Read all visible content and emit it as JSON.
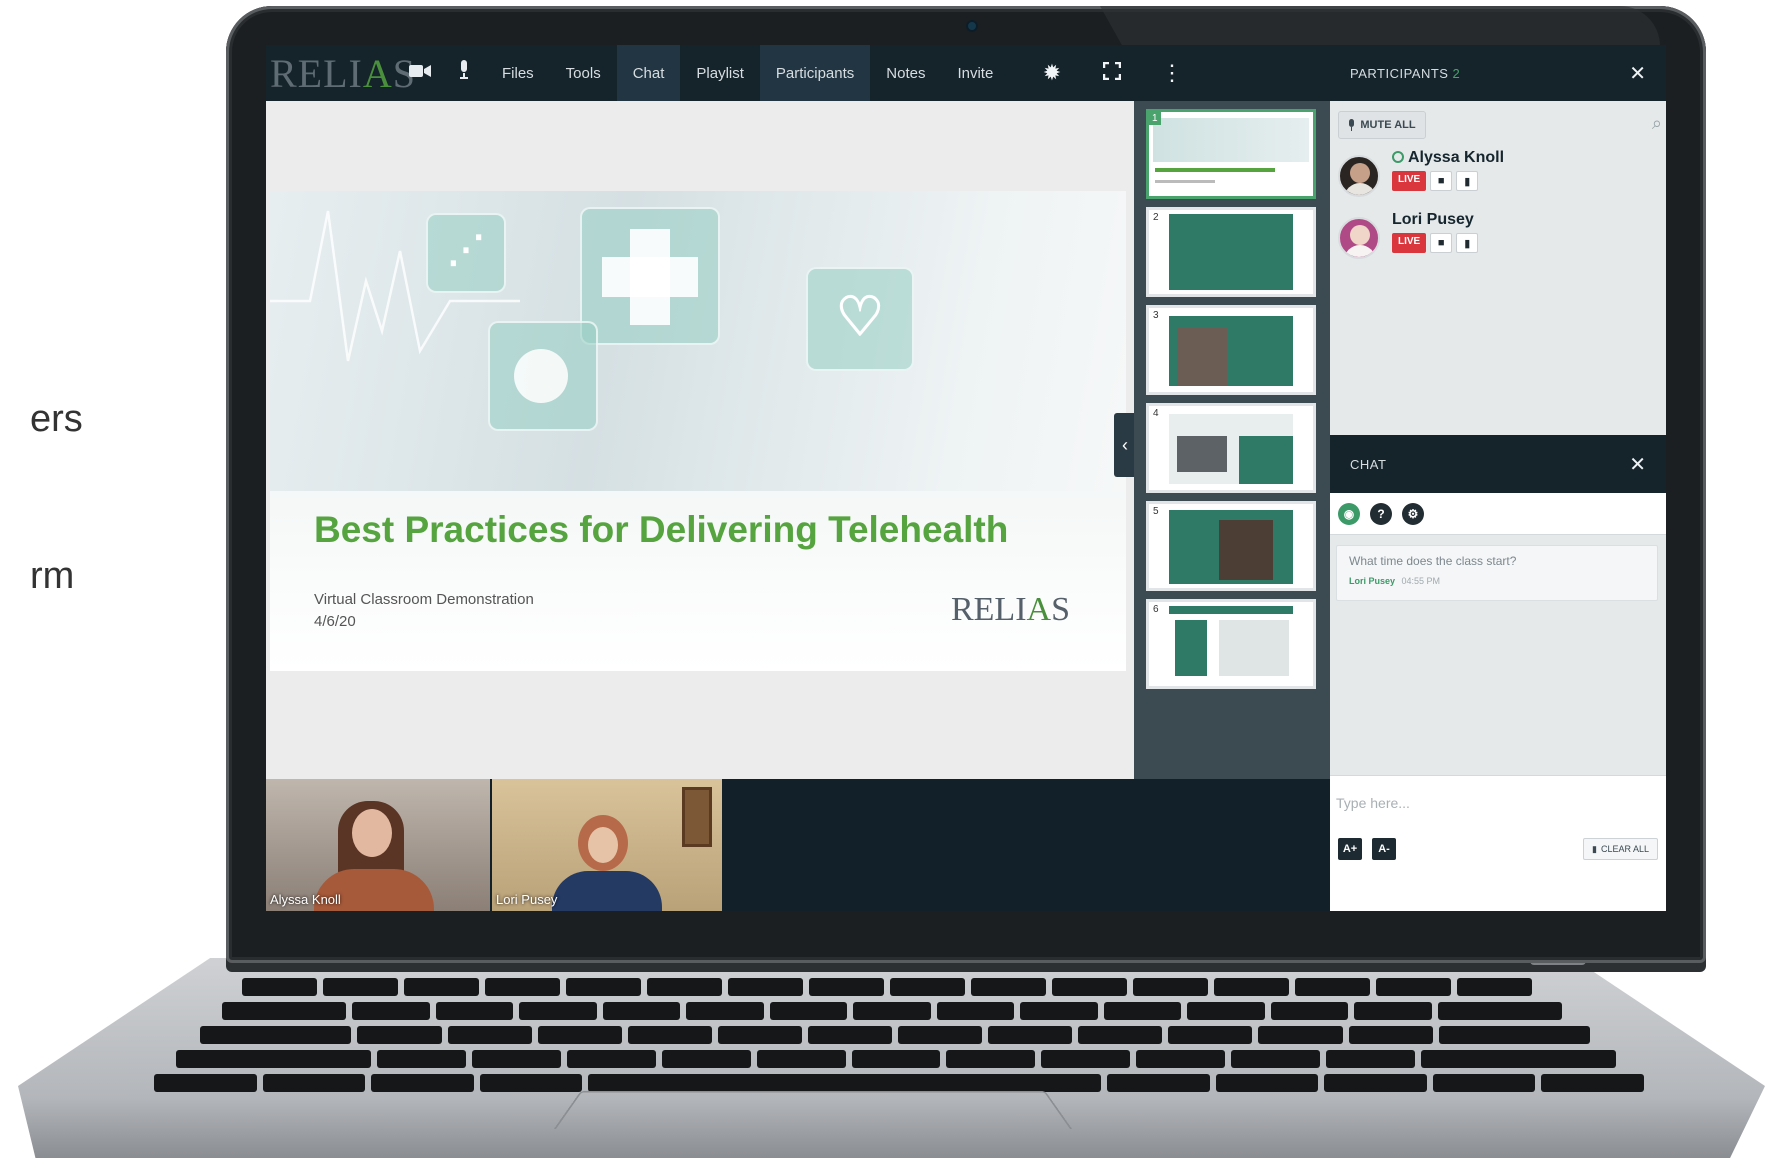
{
  "background_text": {
    "line1": "ers",
    "line2": "rm"
  },
  "topbar": {
    "logo": {
      "pre": "REL",
      "accent": "A",
      "post": "S",
      "accent_lead": "I"
    },
    "icons": {
      "camera": "video-camera-icon",
      "mic": "microphone-icon",
      "settings": "gear-icon",
      "fullscreen": "fullscreen-icon",
      "more": "more-vertical-icon"
    },
    "nav": [
      {
        "label": "Files"
      },
      {
        "label": "Tools"
      },
      {
        "label": "Chat"
      },
      {
        "label": "Playlist"
      },
      {
        "label": "Participants"
      },
      {
        "label": "Notes"
      },
      {
        "label": "Invite"
      }
    ]
  },
  "participants_panel": {
    "title": "PARTICIPANTS",
    "count": "2",
    "mute_all_label": "MUTE ALL",
    "people": [
      {
        "name": "Alyssa Knoll",
        "status": "LIVE"
      },
      {
        "name": "Lori Pusey",
        "status": "LIVE"
      }
    ]
  },
  "slide": {
    "title": "Best Practices for Delivering Telehealth",
    "subtitle": "Virtual Classroom Demonstration",
    "date": "4/6/20",
    "logo": {
      "pre": "REL",
      "accent": "A",
      "post": "S",
      "accent_lead": "I"
    }
  },
  "thumbnails": [
    {
      "number": "1"
    },
    {
      "number": "2"
    },
    {
      "number": "3"
    },
    {
      "number": "4"
    },
    {
      "number": "5"
    },
    {
      "number": "6"
    }
  ],
  "chat": {
    "title": "CHAT",
    "messages": [
      {
        "text": "What time does the class start?",
        "author": "Lori Pusey",
        "time": "04:55 PM"
      }
    ],
    "input_placeholder": "Type here...",
    "font_increase": "A+",
    "font_decrease": "A-",
    "clear_all_label": "CLEAR ALL"
  },
  "videos": [
    {
      "name": "Alyssa Knoll"
    },
    {
      "name": "Lori Pusey"
    }
  ],
  "colors": {
    "brand_green": "#55a43f",
    "live_red": "#d9363e",
    "accent_green": "#3c9a69",
    "dark_bar": "#15232b"
  }
}
